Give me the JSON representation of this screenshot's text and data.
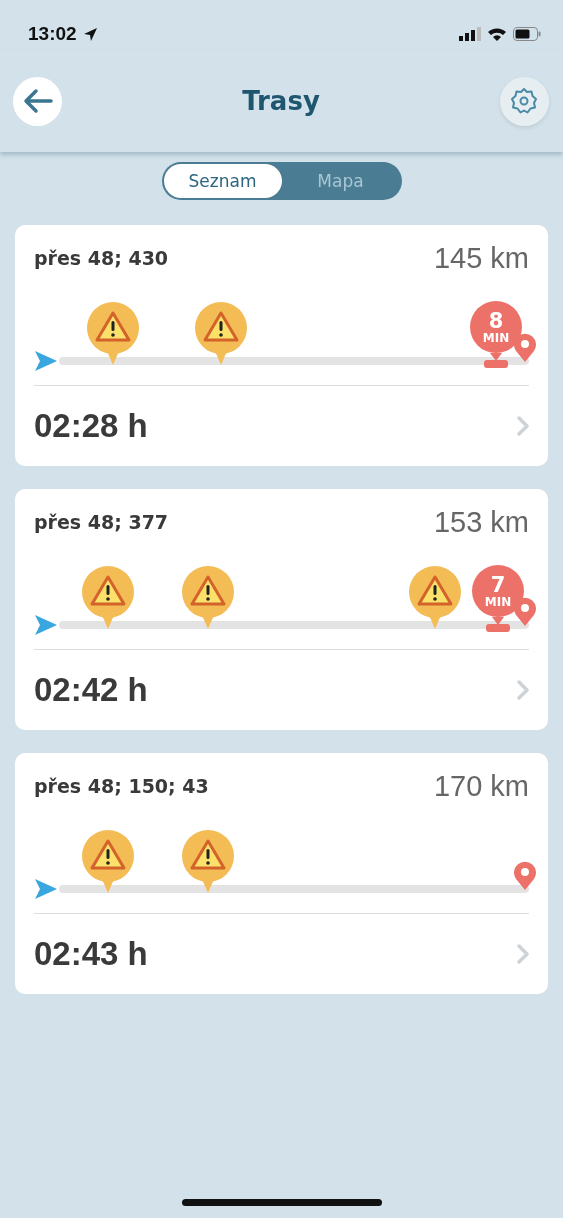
{
  "status_bar": {
    "time": "13:02"
  },
  "header": {
    "title": "Trasy"
  },
  "tabs": [
    {
      "label": "Seznam",
      "selected": true
    },
    {
      "label": "Mapa",
      "selected": false
    }
  ],
  "routes": [
    {
      "via": "přes 48; 430",
      "distance": "145 km",
      "duration": "02:28 h",
      "markers": [
        {
          "kind": "warning"
        },
        {
          "kind": "warning"
        },
        {
          "kind": "delay",
          "value": "8",
          "unit": "MIN"
        }
      ]
    },
    {
      "via": "přes 48; 377",
      "distance": "153 km",
      "duration": "02:42 h",
      "markers": [
        {
          "kind": "warning"
        },
        {
          "kind": "warning"
        },
        {
          "kind": "warning"
        },
        {
          "kind": "delay",
          "value": "7",
          "unit": "MIN"
        }
      ]
    },
    {
      "via": "přes 48; 150; 43",
      "distance": "170 km",
      "duration": "02:43 h",
      "markers": [
        {
          "kind": "warning"
        },
        {
          "kind": "warning"
        }
      ]
    }
  ]
}
